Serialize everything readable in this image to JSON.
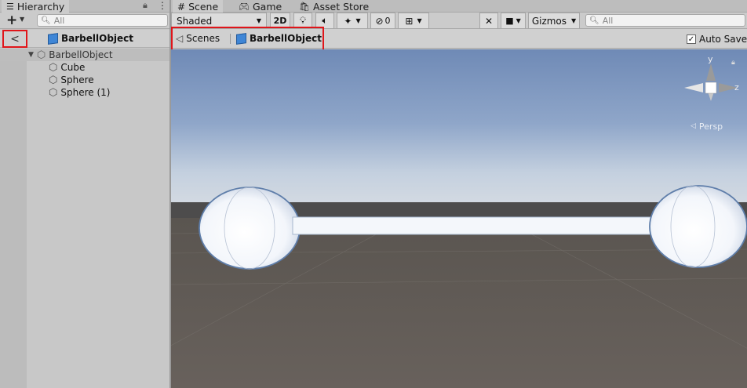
{
  "hierarchy": {
    "tab_label": "Hierarchy",
    "search_placeholder": "All",
    "back_label": "<",
    "prefab_title": "BarbellObject",
    "items": [
      {
        "label": "BarbellObject"
      },
      {
        "label": "Cube"
      },
      {
        "label": "Sphere"
      },
      {
        "label": "Sphere (1)"
      }
    ]
  },
  "tabs": [
    {
      "label": "Scene"
    },
    {
      "label": "Game"
    },
    {
      "label": "Asset Store"
    }
  ],
  "scene_toolbar": {
    "shading": "Shaded",
    "mode_2d": "2D",
    "hidden_count": "0",
    "gizmos": "Gizmos",
    "search_placeholder": "All"
  },
  "breadcrumb": {
    "scenes": "Scenes",
    "prefab": "BarbellObject"
  },
  "auto_save": {
    "label": "Auto Save",
    "checked": true
  },
  "gizmo": {
    "y": "y",
    "z": "z",
    "projection": "Persp"
  },
  "colors": {
    "highlight": "#e0151a",
    "prefab_blue": "#3f86d6"
  }
}
